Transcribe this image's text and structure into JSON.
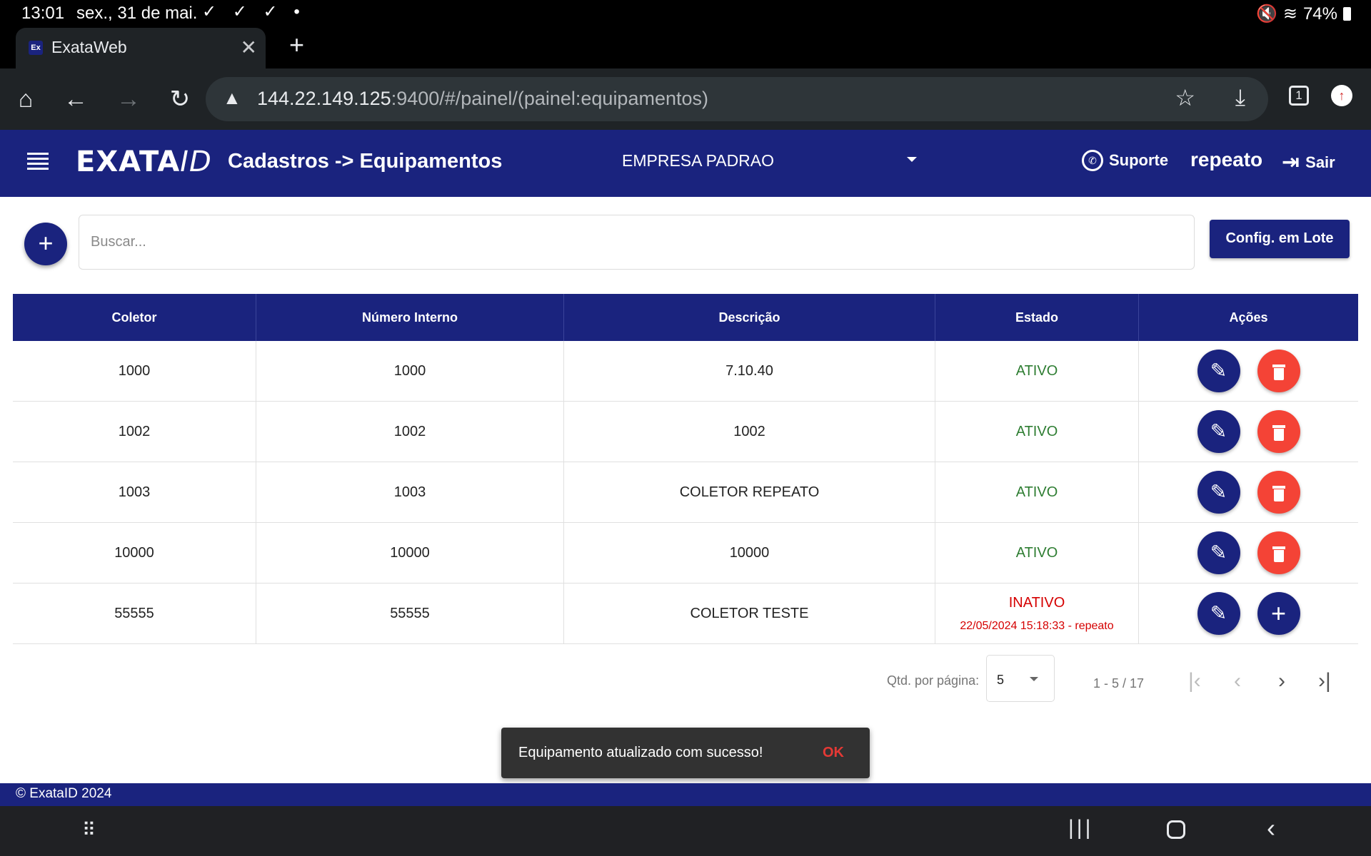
{
  "status_bar": {
    "time": "13:01",
    "date": "sex., 31 de mai.",
    "notifications": "✓ ✓ ✓ •",
    "battery": "74%"
  },
  "browser": {
    "tab_title": "ExataWeb",
    "tab_favicon": "Ex",
    "url_host": "144.22.149.125",
    "url_path": ":9400/#/painel/(painel:equipamentos)",
    "tab_count": "1"
  },
  "header": {
    "logo_main": "EXATA",
    "logo_suffix": "ID",
    "title": "Cadastros -> Equipamentos",
    "company": "EMPRESA PADRAO",
    "support_label": "Suporte",
    "username": "repeato",
    "logout_label": "Sair"
  },
  "toolbar": {
    "search_placeholder": "Buscar...",
    "batch_config_label": "Config. em Lote"
  },
  "table": {
    "columns": [
      "Coletor",
      "Número Interno",
      "Descrição",
      "Estado",
      "Ações"
    ],
    "rows": [
      {
        "coletor": "1000",
        "numero": "1000",
        "descricao": "7.10.40",
        "estado": "ATIVO",
        "estado_detail": ""
      },
      {
        "coletor": "1002",
        "numero": "1002",
        "descricao": "1002",
        "estado": "ATIVO",
        "estado_detail": ""
      },
      {
        "coletor": "1003",
        "numero": "1003",
        "descricao": "COLETOR REPEATO",
        "estado": "ATIVO",
        "estado_detail": ""
      },
      {
        "coletor": "10000",
        "numero": "10000",
        "descricao": "10000",
        "estado": "ATIVO",
        "estado_detail": ""
      },
      {
        "coletor": "55555",
        "numero": "55555",
        "descricao": "COLETOR TESTE",
        "estado": "INATIVO",
        "estado_detail": "22/05/2024 15:18:33 - repeato"
      }
    ]
  },
  "pagination": {
    "per_page_label": "Qtd. por página:",
    "per_page_value": "5",
    "range": "1 - 5 / 17"
  },
  "snackbar": {
    "message": "Equipamento atualizado com sucesso!",
    "action": "OK"
  },
  "footer": {
    "copyright": "© ExataID 2024"
  },
  "colors": {
    "primary": "#1a237e",
    "danger": "#f44336",
    "active": "#2e7d32",
    "inactive": "#d50000"
  }
}
